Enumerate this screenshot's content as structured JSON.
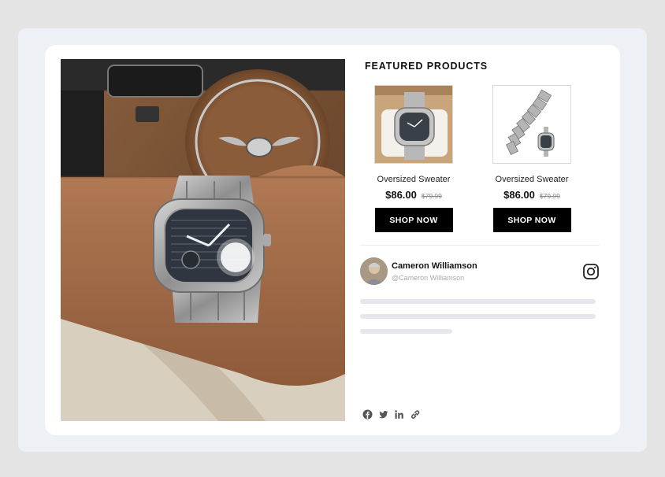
{
  "section_title": "FEATURED PRODUCTS",
  "products": [
    {
      "name": "Oversized Sweater",
      "price": "$86.00",
      "old_price": "$79.99",
      "button": "SHOP NOW",
      "image": "watch-on-pillow"
    },
    {
      "name": "Oversized Sweater",
      "price": "$86.00",
      "old_price": "$79.99",
      "button": "SHOP NOW",
      "image": "watch-open-bracelet"
    }
  ],
  "post": {
    "user_name": "Cameron Williamson",
    "user_handle": "@Cameron Williamson",
    "network_icon": "instagram-icon"
  },
  "share_icons": [
    "facebook-icon",
    "twitter-icon",
    "linkedin-icon",
    "link-icon"
  ],
  "colors": {
    "page_bg": "#e4e4e4",
    "frame_bg": "#edf0f4",
    "card_bg": "#ffffff",
    "button_bg": "#000000",
    "skeleton": "#e6e7ec"
  }
}
